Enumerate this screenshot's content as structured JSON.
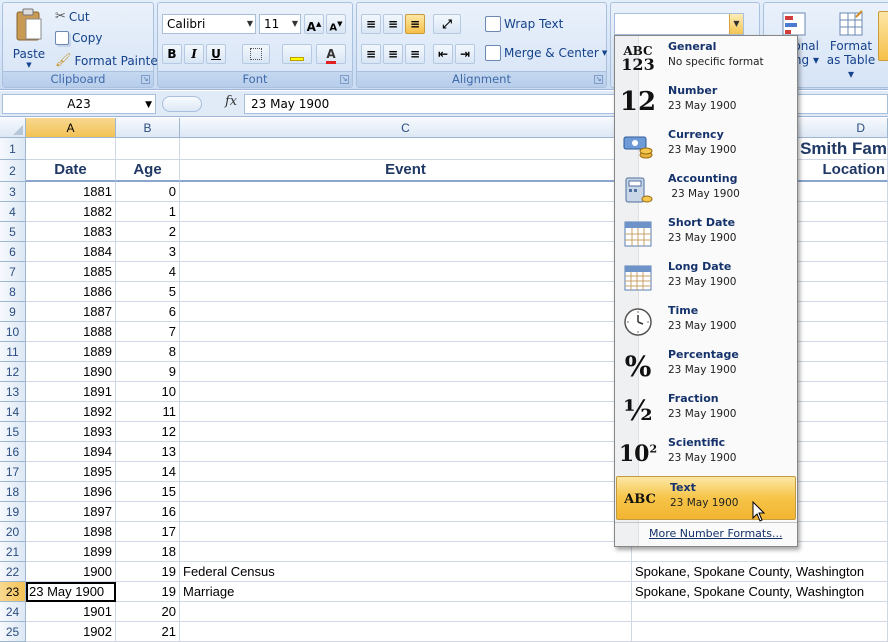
{
  "ribbon": {
    "clipboard": {
      "paste": "Paste",
      "cut": "Cut",
      "copy": "Copy",
      "format_painter": "Format Painter",
      "label": "Clipboard"
    },
    "font": {
      "name": "Calibri",
      "size": "11",
      "label": "Font",
      "bold": "B",
      "italic": "I",
      "underline": "U",
      "grow": "A",
      "shrink": "A",
      "font_color_letter": "A"
    },
    "alignment": {
      "wrap_text": "Wrap Text",
      "merge_center": "Merge & Center",
      "label": "Alignment"
    },
    "number_format": {
      "current": ""
    },
    "styles": {
      "conditional_line1": "onal",
      "conditional_line2": "ing",
      "format_table_line1": "Format",
      "format_table_line2": "as Table"
    }
  },
  "formula_bar": {
    "name_box": "A23",
    "fx": "fx",
    "content": "23 May 1900"
  },
  "sheet": {
    "columns": [
      "A",
      "B",
      "C",
      "D"
    ],
    "title_fragment": "Smith Fam",
    "headers": {
      "date": "Date",
      "age": "Age",
      "event": "Event",
      "location": "Location"
    },
    "rows": [
      {
        "n": "1"
      },
      {
        "n": "2"
      },
      {
        "n": "3",
        "date": "1881",
        "age": "0"
      },
      {
        "n": "4",
        "date": "1882",
        "age": "1"
      },
      {
        "n": "5",
        "date": "1883",
        "age": "2"
      },
      {
        "n": "6",
        "date": "1884",
        "age": "3"
      },
      {
        "n": "7",
        "date": "1885",
        "age": "4"
      },
      {
        "n": "8",
        "date": "1886",
        "age": "5"
      },
      {
        "n": "9",
        "date": "1887",
        "age": "6"
      },
      {
        "n": "10",
        "date": "1888",
        "age": "7"
      },
      {
        "n": "11",
        "date": "1889",
        "age": "8"
      },
      {
        "n": "12",
        "date": "1890",
        "age": "9"
      },
      {
        "n": "13",
        "date": "1891",
        "age": "10"
      },
      {
        "n": "14",
        "date": "1892",
        "age": "11"
      },
      {
        "n": "15",
        "date": "1893",
        "age": "12"
      },
      {
        "n": "16",
        "date": "1894",
        "age": "13"
      },
      {
        "n": "17",
        "date": "1895",
        "age": "14"
      },
      {
        "n": "18",
        "date": "1896",
        "age": "15"
      },
      {
        "n": "19",
        "date": "1897",
        "age": "16"
      },
      {
        "n": "20",
        "date": "1898",
        "age": "17"
      },
      {
        "n": "21",
        "date": "1899",
        "age": "18"
      },
      {
        "n": "22",
        "date": "1900",
        "age": "19",
        "event": "Federal Census",
        "location": "Spokane, Spokane County, Washington"
      },
      {
        "n": "23",
        "date": "23 May 1900",
        "age": "19",
        "event": "Marriage",
        "location": "Spokane, Spokane County, Washington"
      },
      {
        "n": "24",
        "date": "1901",
        "age": "20"
      },
      {
        "n": "25",
        "date": "1902",
        "age": "21"
      }
    ]
  },
  "number_format_menu": {
    "items": [
      {
        "name": "General",
        "sample": "No specific format",
        "icon": "general-format-icon",
        "glyph1": "ABC",
        "glyph2": "123"
      },
      {
        "name": "Number",
        "sample": "23 May 1900",
        "icon": "number-format-icon",
        "glyph1": "12"
      },
      {
        "name": "Currency",
        "sample": "23 May 1900",
        "icon": "currency-format-icon"
      },
      {
        "name": "Accounting",
        "sample": " 23 May 1900",
        "icon": "accounting-format-icon"
      },
      {
        "name": "Short Date",
        "sample": "23 May 1900",
        "icon": "short-date-format-icon"
      },
      {
        "name": "Long Date",
        "sample": "23 May 1900",
        "icon": "long-date-format-icon"
      },
      {
        "name": "Time",
        "sample": "23 May 1900",
        "icon": "time-format-icon"
      },
      {
        "name": "Percentage",
        "sample": "23 May 1900",
        "icon": "percentage-format-icon",
        "glyph1": "%"
      },
      {
        "name": "Fraction",
        "sample": "23 May 1900",
        "icon": "fraction-format-icon",
        "glyph1": "½"
      },
      {
        "name": "Scientific",
        "sample": "23 May 1900",
        "icon": "scientific-format-icon",
        "glyph1": "10",
        "glyph2": "2"
      },
      {
        "name": "Text",
        "sample": "23 May 1900",
        "icon": "text-format-icon",
        "glyph1": "ABC"
      }
    ],
    "selected": "Text",
    "more": "More Number Formats..."
  },
  "colors": {
    "selected_item": "#f6c448",
    "header_active": "#f3c255",
    "ribbon_text": "#15428b"
  }
}
